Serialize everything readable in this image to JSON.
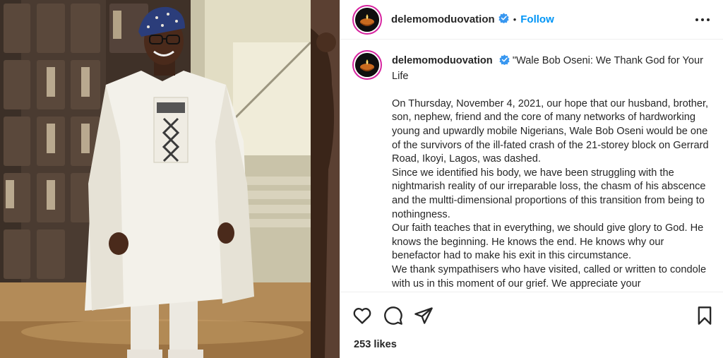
{
  "post": {
    "username": "delemomoduovation",
    "follow_label": "Follow",
    "separator": "•",
    "caption_title": "\"Wale Bob Oseni: We Thank God for Your Life",
    "caption_paragraphs": [
      "On Thursday, November 4, 2021, our hope that our husband, brother, son, nephew, friend and the core of many networks of hardworking young and upwardly mobile Nigerians, Wale Bob Oseni would be one of the survivors of the ill-fated crash of the 21-storey block on Gerrard Road, Ikoyi, Lagos, was dashed.",
      "Since we identified his body, we have been struggling with the nightmarish reality of our irreparable loss, the chasm of his abscence and the multti-dimensional proportions of this transition from being to nothingness.",
      "Our faith teaches that in everything, we should give glory to God. He knows the beginning. He knows the end. He knows why our benefactor had to make his exit in this circumstance.",
      "We thank sympathisers who have visited, called or written to condole with us in this moment of our grief. We appreciate your"
    ],
    "likes_text": "253 likes"
  },
  "icons": {
    "more": "more-options-icon",
    "verified": "verified-badge-icon",
    "like": "heart-icon",
    "comment": "comment-icon",
    "share": "paper-plane-icon",
    "save": "bookmark-icon",
    "avatar": "candle-icon"
  },
  "colors": {
    "link_blue": "#0095f6",
    "verified_blue": "#3897f0",
    "story_ring": "#d6249f",
    "text": "#262626",
    "divider": "#efefef"
  }
}
